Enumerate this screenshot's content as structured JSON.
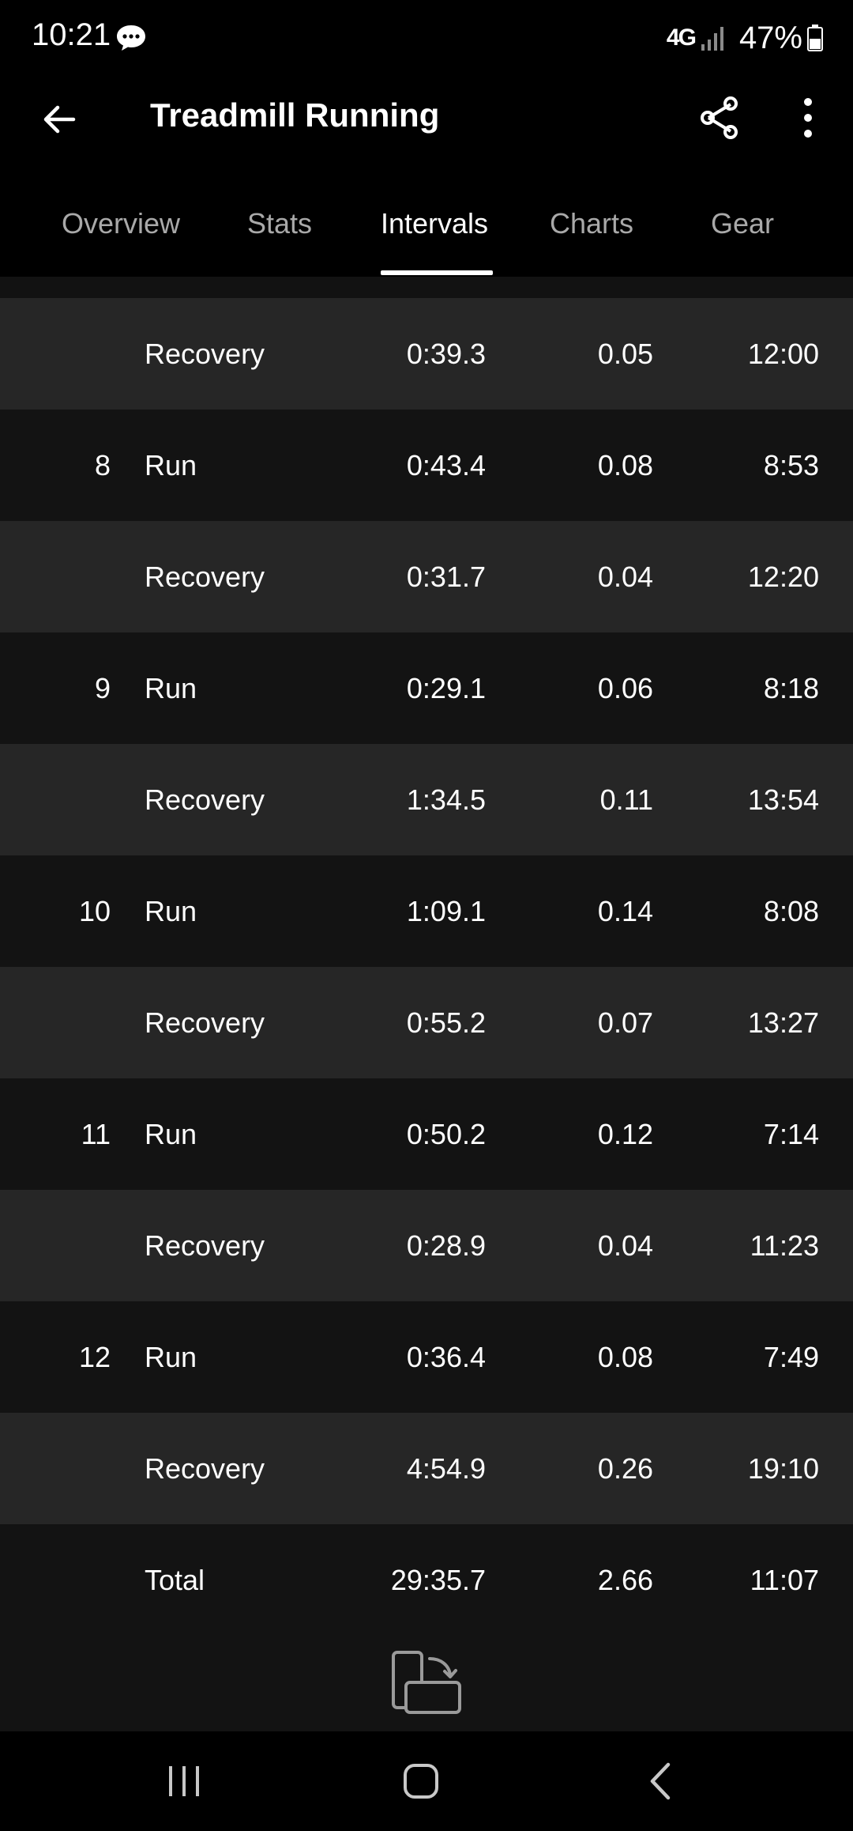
{
  "status_bar": {
    "time": "10:21",
    "network": "4G",
    "battery": "47%"
  },
  "app_bar": {
    "title": "Treadmill Running"
  },
  "tabs": [
    {
      "label": "Overview"
    },
    {
      "label": "Stats"
    },
    {
      "label": "Intervals"
    },
    {
      "label": "Charts"
    },
    {
      "label": "Gear"
    }
  ],
  "active_tab": "Intervals",
  "intervals": [
    {
      "num": "",
      "type": "Recovery",
      "time": "0:39.3",
      "distance": "0.05",
      "pace": "12:00"
    },
    {
      "num": "8",
      "type": "Run",
      "time": "0:43.4",
      "distance": "0.08",
      "pace": "8:53"
    },
    {
      "num": "",
      "type": "Recovery",
      "time": "0:31.7",
      "distance": "0.04",
      "pace": "12:20"
    },
    {
      "num": "9",
      "type": "Run",
      "time": "0:29.1",
      "distance": "0.06",
      "pace": "8:18"
    },
    {
      "num": "",
      "type": "Recovery",
      "time": "1:34.5",
      "distance": "0.11",
      "pace": "13:54"
    },
    {
      "num": "10",
      "type": "Run",
      "time": "1:09.1",
      "distance": "0.14",
      "pace": "8:08"
    },
    {
      "num": "",
      "type": "Recovery",
      "time": "0:55.2",
      "distance": "0.07",
      "pace": "13:27"
    },
    {
      "num": "11",
      "type": "Run",
      "time": "0:50.2",
      "distance": "0.12",
      "pace": "7:14"
    },
    {
      "num": "",
      "type": "Recovery",
      "time": "0:28.9",
      "distance": "0.04",
      "pace": "11:23"
    },
    {
      "num": "12",
      "type": "Run",
      "time": "0:36.4",
      "distance": "0.08",
      "pace": "7:49"
    },
    {
      "num": "",
      "type": "Recovery",
      "time": "4:54.9",
      "distance": "0.26",
      "pace": "19:10"
    }
  ],
  "total": {
    "label": "Total",
    "time": "29:35.7",
    "distance": "2.66",
    "pace": "11:07"
  },
  "icons": {
    "back": "arrow-left-icon",
    "share": "share-icon",
    "more": "more-vertical-icon",
    "rotate": "screen-rotate-icon"
  },
  "colors": {
    "background": "#000000",
    "row_light": "#262626",
    "row_dark": "#131313",
    "tab_inactive": "#a9a9a9",
    "text": "#ffffff"
  }
}
